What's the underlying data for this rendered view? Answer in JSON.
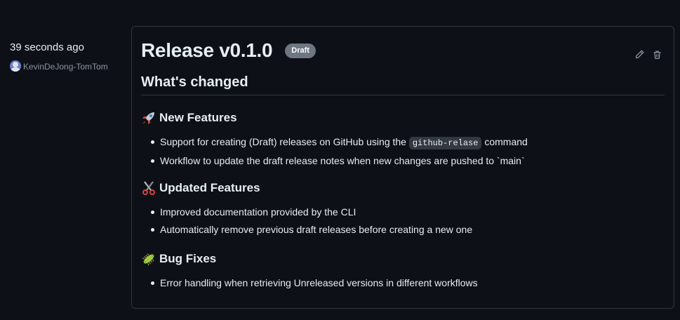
{
  "meta": {
    "time": "39 seconds ago",
    "author": "KevinDeJong-TomTom"
  },
  "release": {
    "title": "Release v0.1.0",
    "badge": "Draft",
    "heading": "What's changed",
    "groups": [
      {
        "icon": "rocket-icon",
        "title": "New Features",
        "items": [
          {
            "before": "Support for creating (Draft) releases on GitHub using the ",
            "code": "github-relase",
            "after": " command"
          },
          {
            "text": "Workflow to update the draft release notes when new changes are pushed to `main`"
          }
        ]
      },
      {
        "icon": "scissors-icon",
        "title": "Updated Features",
        "items": [
          {
            "text": "Improved documentation provided by the CLI"
          },
          {
            "text": "Automatically remove previous draft releases before creating a new one"
          }
        ]
      },
      {
        "icon": "bug-icon",
        "title": "Bug Fixes",
        "items": [
          {
            "text": "Error handling when retrieving Unreleased versions in different workflows"
          }
        ]
      }
    ]
  },
  "actions": {
    "edit_icon": "pencil-icon",
    "delete_icon": "trash-icon"
  },
  "colors": {
    "background": "#0d1117",
    "border": "#30363d",
    "text": "#e6edf3",
    "muted": "#8b949e",
    "badge": "#6e7681"
  }
}
